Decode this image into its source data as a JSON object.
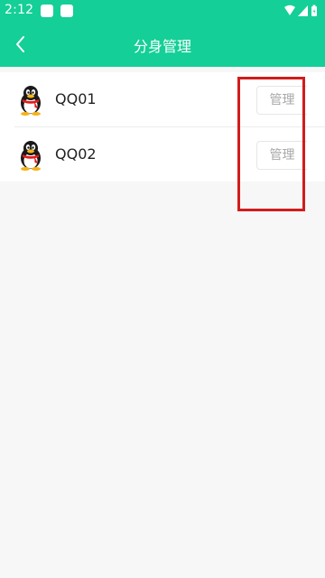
{
  "status_bar": {
    "time": "2:12"
  },
  "header": {
    "title": "分身管理"
  },
  "accounts": [
    {
      "name": "QQ01",
      "action_label": "管理"
    },
    {
      "name": "QQ02",
      "action_label": "管理"
    }
  ],
  "colors": {
    "brand": "#14cf97",
    "highlight": "#d31b1b",
    "background": "#f7f7f7"
  },
  "icons": {
    "back": "chevron-left-icon",
    "avatar": "qq-penguin-icon",
    "wifi": "wifi-icon",
    "signal": "signal-icon",
    "battery": "battery-icon"
  }
}
